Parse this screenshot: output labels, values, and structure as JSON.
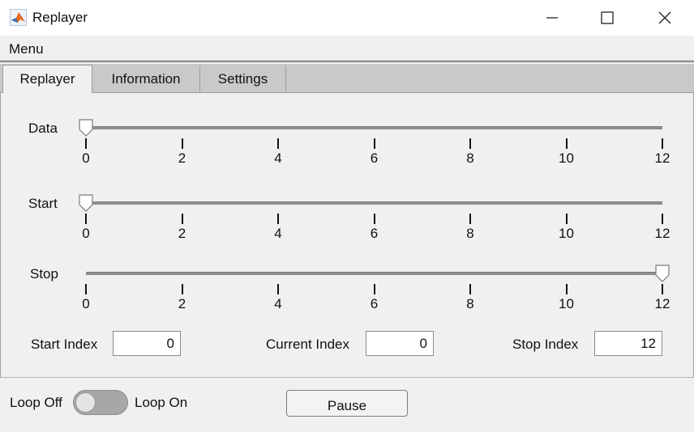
{
  "window": {
    "title": "Replayer",
    "icon": "matlab-icon",
    "controls": [
      "minimize-icon",
      "maximize-icon",
      "close-icon"
    ]
  },
  "menu": {
    "label": "Menu"
  },
  "tabs": [
    {
      "label": "Replayer",
      "active": true
    },
    {
      "label": "Information",
      "active": false
    },
    {
      "label": "Settings",
      "active": false
    }
  ],
  "sliders": {
    "ticks": [
      "0",
      "2",
      "4",
      "6",
      "8",
      "10",
      "12"
    ],
    "range": [
      0,
      12
    ],
    "data": {
      "label": "Data",
      "value": 0
    },
    "start": {
      "label": "Start",
      "value": 0
    },
    "stop": {
      "label": "Stop",
      "value": 12
    }
  },
  "fields": {
    "start_index": {
      "label": "Start Index",
      "value": "0"
    },
    "current_index": {
      "label": "Current Index",
      "value": "0"
    },
    "stop_index": {
      "label": "Stop Index",
      "value": "12"
    }
  },
  "loop": {
    "off_label": "Loop Off",
    "on_label": "Loop On",
    "state": "off"
  },
  "pause_button": {
    "label": "Pause"
  }
}
